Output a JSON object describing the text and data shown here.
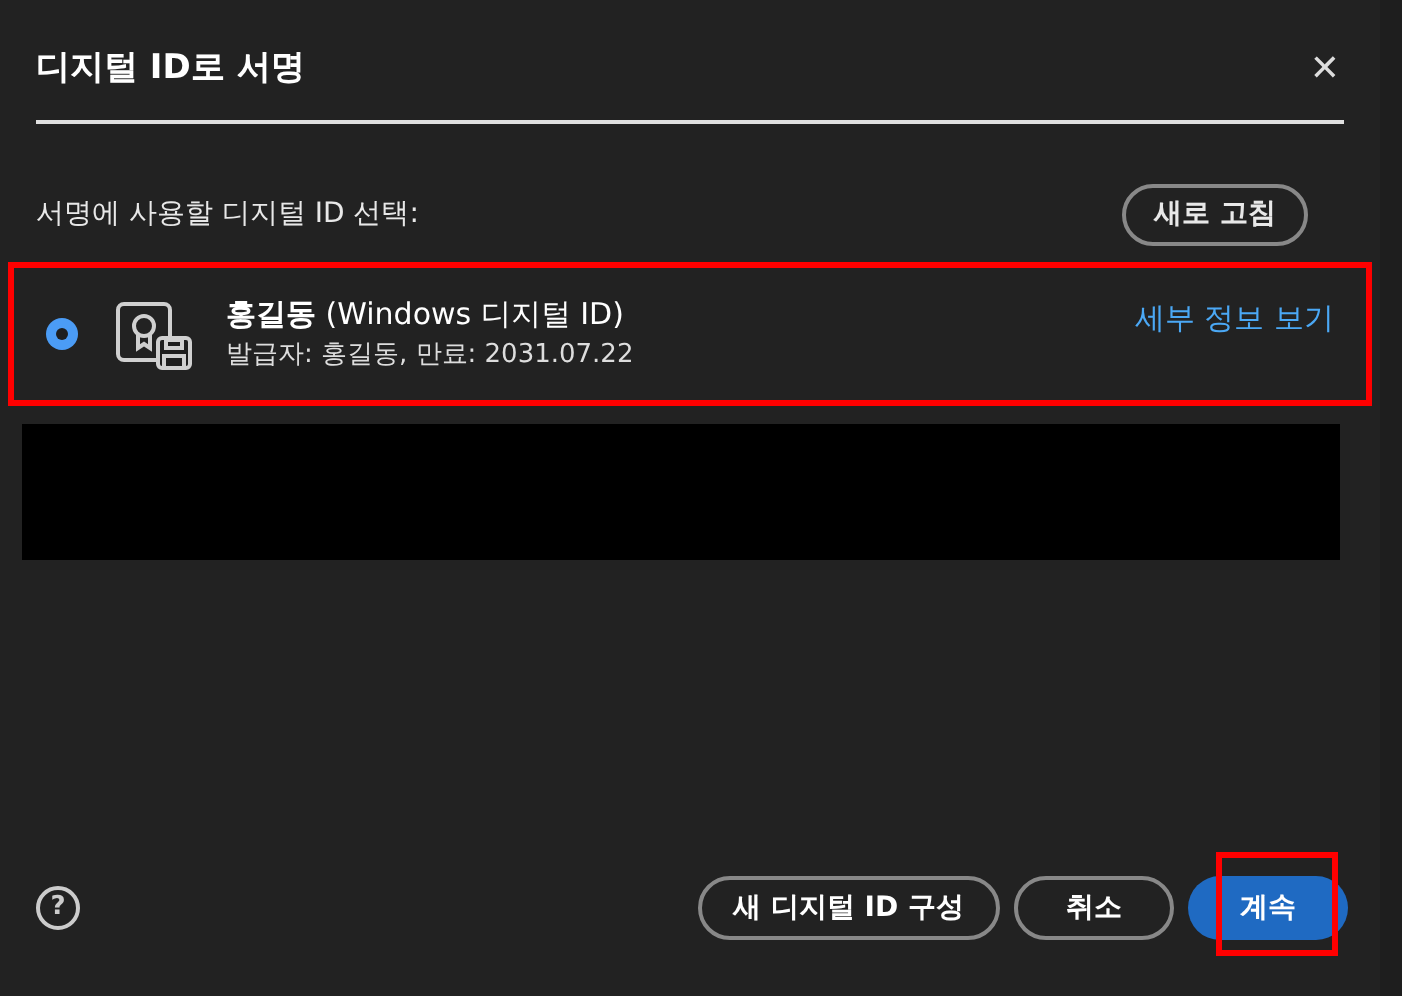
{
  "dialog": {
    "title": "디지털 ID로 서명",
    "close": "✕"
  },
  "prompt": "서명에 사용할 디지털 ID 선택:",
  "refresh_button": "새로 고침",
  "ids": [
    {
      "name": "홍길동",
      "type": "(Windows 디지털 ID)",
      "details": "발급자: 홍길동, 만료: 2031.07.22",
      "link": "세부 정보 보기",
      "selected": true,
      "highlighted": true
    }
  ],
  "redacted": true,
  "footer": {
    "help": "?",
    "buttons": [
      {
        "label": "새 디지털 ID 구성",
        "kind": "secondary",
        "highlighted": false
      },
      {
        "label": "취소",
        "kind": "secondary",
        "highlighted": false
      },
      {
        "label": "계속",
        "kind": "primary",
        "highlighted": true
      }
    ]
  }
}
